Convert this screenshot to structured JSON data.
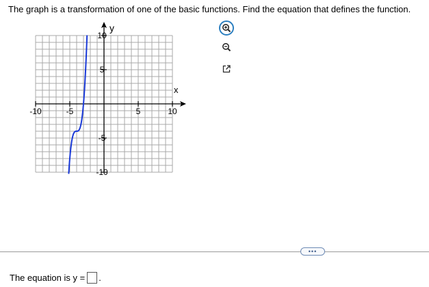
{
  "question": {
    "text": "The graph is a transformation of one of the basic functions. Find the equation that defines the function."
  },
  "graph": {
    "x_axis_label": "x",
    "y_axis_label": "y",
    "x_ticks": [
      "-10",
      "-5",
      "5",
      "10"
    ],
    "y_ticks": [
      "10",
      "5",
      "-5",
      "-10"
    ],
    "x_range": [
      -10,
      10
    ],
    "y_range": [
      -10,
      10
    ],
    "grid": true,
    "curve_color": "#1a3ad8"
  },
  "tools": {
    "zoom_in": "magnifier-plus-icon",
    "zoom_out": "magnifier-minus-icon",
    "popout": "external-window-icon"
  },
  "more": {
    "label": "•••"
  },
  "answer": {
    "prefix": "The equation is y =",
    "value": "",
    "suffix": "."
  }
}
